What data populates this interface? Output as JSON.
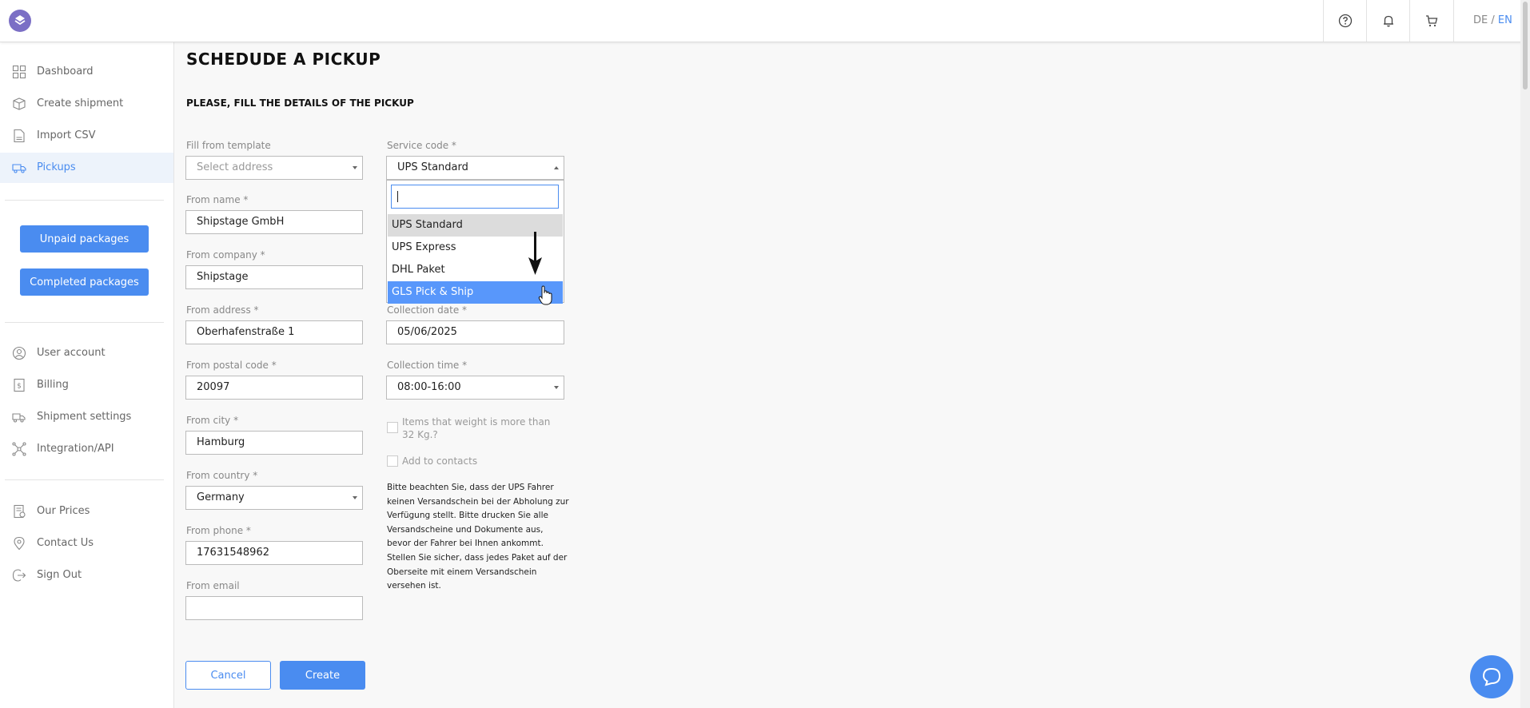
{
  "header": {
    "lang_de": "DE",
    "lang_sep": " / ",
    "lang_en": "EN",
    "accent_color": "#4a8cf0"
  },
  "sidebar": {
    "items": [
      {
        "label": "Dashboard",
        "icon": "grid-icon"
      },
      {
        "label": "Create shipment",
        "icon": "box-icon"
      },
      {
        "label": "Import CSV",
        "icon": "file-icon"
      },
      {
        "label": "Pickups",
        "icon": "truck-icon",
        "active": true
      }
    ],
    "buttons": {
      "unpaid": "Unpaid packages",
      "completed": "Completed packages"
    },
    "account_items": [
      {
        "label": "User account",
        "icon": "user-icon"
      },
      {
        "label": "Billing",
        "icon": "billing-icon"
      },
      {
        "label": "Shipment settings",
        "icon": "settings-truck-icon"
      },
      {
        "label": "Integration/API",
        "icon": "integration-icon"
      }
    ],
    "footer_items": [
      {
        "label": "Our Prices",
        "icon": "prices-icon"
      },
      {
        "label": "Contact Us",
        "icon": "location-icon"
      },
      {
        "label": "Sign Out",
        "icon": "sign-out-icon"
      }
    ]
  },
  "main": {
    "title": "SCHEDUDE A PICKUP",
    "subtitle": "PLEASE, FILL THE DETAILS OF THE PICKUP",
    "left": {
      "template_label": "Fill from template",
      "template_placeholder": "Select address",
      "from_name_label": "From name *",
      "from_name": "Shipstage GmbH",
      "from_company_label": "From company *",
      "from_company": "Shipstage",
      "from_address_label": "From address *",
      "from_address": "Oberhafenstraße 1",
      "from_postal_label": "From postal code *",
      "from_postal": "20097",
      "from_city_label": "From city *",
      "from_city": "Hamburg",
      "from_country_label": "From country *",
      "from_country": "Germany",
      "from_phone_label": "From phone *",
      "from_phone": "17631548962",
      "from_email_label": "From email",
      "from_email": ""
    },
    "right": {
      "service_label": "Service code *",
      "service_value": "UPS Standard",
      "service_options": [
        "UPS Standard",
        "UPS Express",
        "DHL Paket",
        "GLS Pick & Ship"
      ],
      "collection_date_label": "Collection date *",
      "collection_date": "05/06/2025",
      "collection_time_label": "Collection time *",
      "collection_time": "08:00-16:00",
      "heavy_items_label": "Items that weight is more than 32 Kg.?",
      "add_contacts_label": "Add to contacts",
      "notice": "Bitte beachten Sie, dass der UPS Fahrer keinen Versandschein bei der Abholung zur Verfügung stellt. Bitte drucken Sie alle Versandscheine und Dokumente aus, bevor der Fahrer bei Ihnen ankommt. Stellen Sie sicher, dass jedes Paket auf der Oberseite mit einem Versandschein versehen ist."
    },
    "actions": {
      "cancel": "Cancel",
      "create": "Create"
    }
  }
}
